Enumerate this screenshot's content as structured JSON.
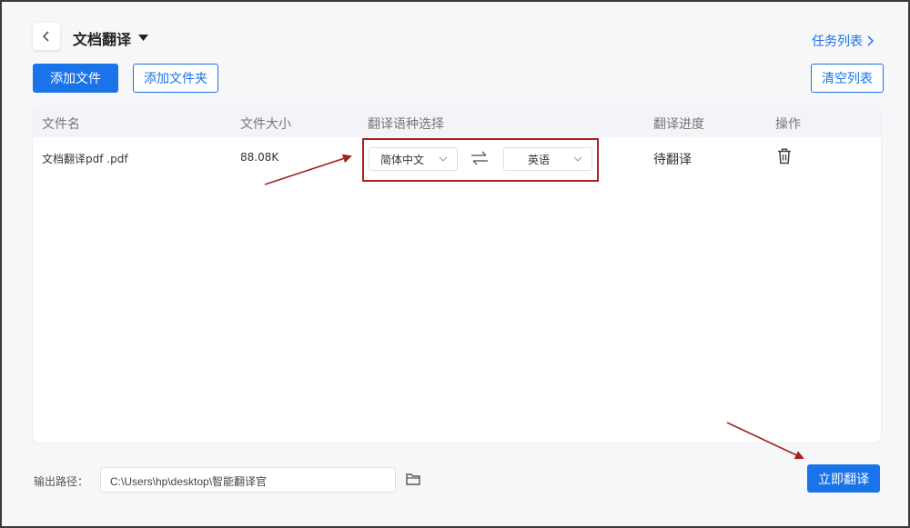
{
  "header": {
    "title": "文档翻译",
    "task_list": "任务列表"
  },
  "toolbar": {
    "add_file": "添加文件",
    "add_folder": "添加文件夹",
    "clear_list": "清空列表"
  },
  "table": {
    "columns": [
      "文件名",
      "文件大小",
      "翻译语种选择",
      "翻译进度",
      "操作"
    ],
    "rows": [
      {
        "file_name": "文档翻译pdf .pdf",
        "file_size": "88.08K",
        "source_lang": "简体中文",
        "target_lang": "英语",
        "progress": "待翻译"
      }
    ]
  },
  "footer": {
    "output_label": "输出路径：",
    "output_path": "C:\\Users\\hp\\desktop\\智能翻译官",
    "translate_now": "立即翻译"
  },
  "colors": {
    "accent": "#1a73e8",
    "annotation": "#a82323"
  },
  "icons": [
    "back-icon",
    "caret-down-icon",
    "chevron-right-icon",
    "swap-icon",
    "trash-icon",
    "folder-icon"
  ]
}
